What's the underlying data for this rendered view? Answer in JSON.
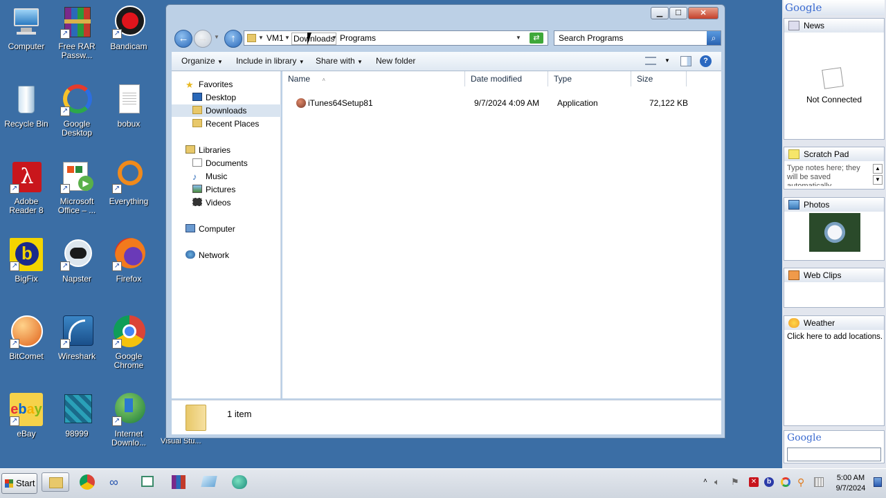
{
  "desktop": {
    "icons": [
      {
        "label": "Computer",
        "icon": "computer-icon"
      },
      {
        "label": "Free RAR Passw...",
        "icon": "winrar-icon"
      },
      {
        "label": "Bandicam",
        "icon": "bandicam-icon"
      },
      {
        "label": "Recycle Bin",
        "icon": "recycle-bin-icon"
      },
      {
        "label": "Google Desktop",
        "icon": "google-desktop-icon"
      },
      {
        "label": "bobux",
        "icon": "document-icon"
      },
      {
        "label": "Adobe Reader 8",
        "icon": "adobe-reader-icon"
      },
      {
        "label": "Microsoft Office – ...",
        "icon": "ms-office-icon"
      },
      {
        "label": "Everything",
        "icon": "everything-icon"
      },
      {
        "label": "BigFix",
        "icon": "bigfix-icon"
      },
      {
        "label": "Napster",
        "icon": "napster-icon"
      },
      {
        "label": "Firefox",
        "icon": "firefox-icon"
      },
      {
        "label": "BitComet",
        "icon": "bitcomet-icon"
      },
      {
        "label": "Wireshark",
        "icon": "wireshark-icon"
      },
      {
        "label": "Google Chrome",
        "icon": "chrome-icon"
      },
      {
        "label": "eBay",
        "icon": "ebay-icon"
      },
      {
        "label": "98999",
        "icon": "installer-icon"
      },
      {
        "label": "Internet Downlo...",
        "icon": "idm-icon"
      }
    ],
    "partial_labels": [
      "Visual Stu..."
    ]
  },
  "explorer": {
    "breadcrumb": [
      "VM1",
      "Downloads",
      "Programs"
    ],
    "search_placeholder": "Search Programs",
    "toolbar": {
      "organize": "Organize",
      "include": "Include in library",
      "share": "Share with",
      "new_folder": "New folder"
    },
    "nav": {
      "favorites": "Favorites",
      "desktop": "Desktop",
      "downloads": "Downloads",
      "recent": "Recent Places",
      "libraries": "Libraries",
      "documents": "Documents",
      "music": "Music",
      "pictures": "Pictures",
      "videos": "Videos",
      "computer": "Computer",
      "network": "Network"
    },
    "columns": [
      "Name",
      "Date modified",
      "Type",
      "Size"
    ],
    "files": [
      {
        "name": "iTunes64Setup81",
        "date": "9/7/2024 4:09 AM",
        "type": "Application",
        "size": "72,122 KB"
      }
    ],
    "status": "1 item"
  },
  "gadgets": {
    "logo": "Google",
    "news_title": "News",
    "news_status": "Not Connected",
    "scratch_title": "Scratch Pad",
    "scratch_text": "Type notes here; they will be saved automatically.",
    "photos_title": "Photos",
    "webclips_title": "Web Clips",
    "weather_title": "Weather",
    "weather_text": "Click here to add locations.",
    "search_logo": "Google"
  },
  "taskbar": {
    "start": "Start",
    "time": "5:00 AM",
    "date": "9/7/2024"
  }
}
